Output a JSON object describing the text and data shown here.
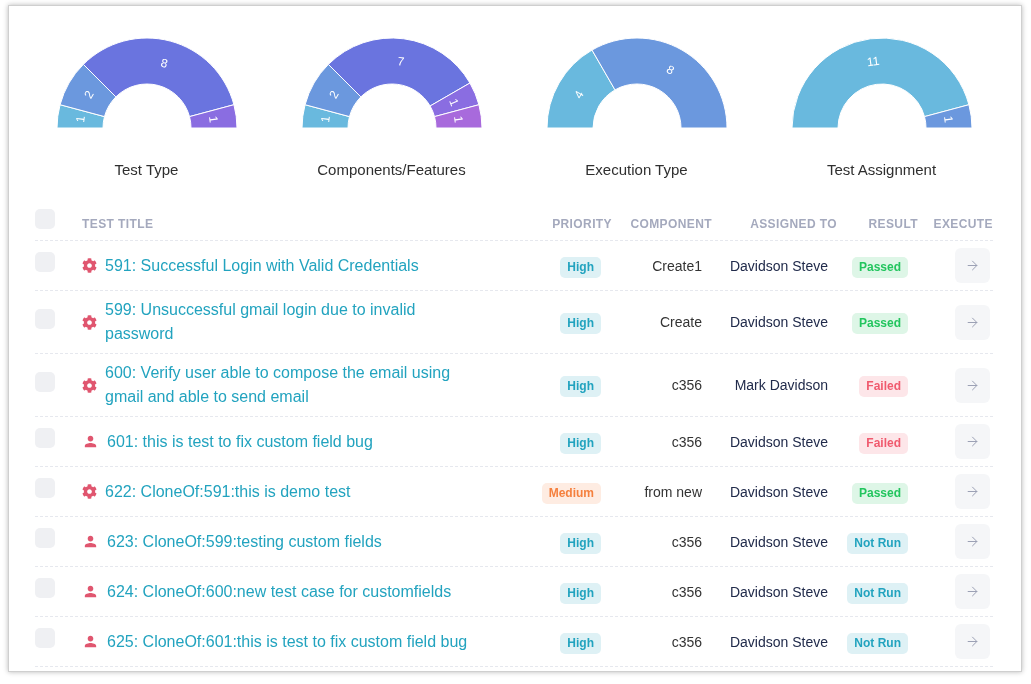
{
  "charts": [
    {
      "chart_data": {
        "type": "donut",
        "title": "Test Type",
        "values": [
          1,
          2,
          8,
          1
        ],
        "data_labels": true
      }
    },
    {
      "chart_data": {
        "type": "donut",
        "title": "Components/Features",
        "values": [
          1,
          2,
          7,
          1,
          1
        ],
        "data_labels": true
      }
    },
    {
      "chart_data": {
        "type": "donut",
        "title": "Execution Type",
        "values": [
          4,
          8
        ],
        "data_labels": true
      }
    },
    {
      "chart_data": {
        "type": "donut",
        "title": "Test Assignment",
        "values": [
          11,
          1
        ],
        "data_labels": true
      }
    }
  ],
  "table": {
    "select_all": {
      "checked": false
    },
    "columns": [
      "TEST TITLE",
      "PRIORITY",
      "COMPONENT",
      "ASSIGNED TO",
      "RESULT",
      "EXECUTE"
    ],
    "rows": [
      {
        "checked": false,
        "kind": "automated",
        "title": "591: Successful Login with Valid Credentials",
        "priority": {
          "label": "High",
          "color": "#22a3bf"
        },
        "component": "Create1",
        "assigned_to": "Davidson Steve",
        "result": {
          "label": "Passed",
          "color": "#22c55e"
        }
      },
      {
        "checked": false,
        "kind": "automated",
        "title": "599: Unsuccessful gmail login due to invalid password",
        "priority": {
          "label": "High",
          "color": "#22a3bf"
        },
        "component": "Create",
        "assigned_to": "Davidson Steve",
        "result": {
          "label": "Passed",
          "color": "#22c55e"
        }
      },
      {
        "checked": false,
        "kind": "automated",
        "title": "600: Verify user able to compose the email using gmail and able to send email",
        "priority": {
          "label": "High",
          "color": "#22a3bf"
        },
        "component": "c356",
        "assigned_to": "Mark Davidson",
        "result": {
          "label": "Failed",
          "color": "#f05a6e"
        }
      },
      {
        "checked": false,
        "kind": "manual",
        "title": "601: this is test to fix custom field bug",
        "priority": {
          "label": "High",
          "color": "#22a3bf"
        },
        "component": "c356",
        "assigned_to": "Davidson Steve",
        "result": {
          "label": "Failed",
          "color": "#f05a6e"
        }
      },
      {
        "checked": false,
        "kind": "automated",
        "title": "622: CloneOf:591:this is demo test",
        "priority": {
          "label": "Medium",
          "color": "#f5803e"
        },
        "component": "from new",
        "assigned_to": "Davidson Steve",
        "result": {
          "label": "Passed",
          "color": "#22c55e"
        }
      },
      {
        "checked": false,
        "kind": "manual",
        "title": "623: CloneOf:599:testing custom fields",
        "priority": {
          "label": "High",
          "color": "#22a3bf"
        },
        "component": "c356",
        "assigned_to": "Davidson Steve",
        "result": {
          "label": "Not Run",
          "color": "#22a3bf"
        }
      },
      {
        "checked": false,
        "kind": "manual",
        "title": "624: CloneOf:600:new test case for customfields",
        "priority": {
          "label": "High",
          "color": "#22a3bf"
        },
        "component": "c356",
        "assigned_to": "Davidson Steve",
        "result": {
          "label": "Not Run",
          "color": "#22a3bf"
        }
      },
      {
        "checked": false,
        "kind": "manual",
        "title": "625: CloneOf:601:this is test to fix custom field bug",
        "priority": {
          "label": "High",
          "color": "#22a3bf"
        },
        "component": "c356",
        "assigned_to": "Davidson Steve",
        "result": {
          "label": "Not Run",
          "color": "#22a3bf"
        }
      }
    ]
  }
}
